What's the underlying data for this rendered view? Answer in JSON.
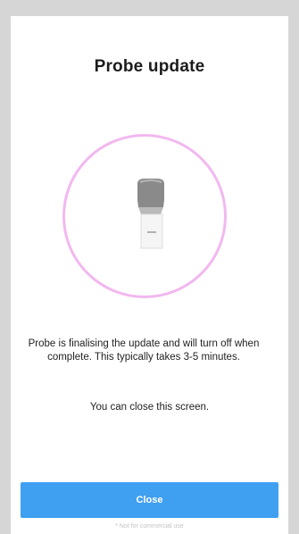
{
  "screen": {
    "title": "Probe update",
    "message": "Probe is finalising the update and will turn off when complete. This typically takes 3-5 minutes.",
    "close_note": "You can close this screen.",
    "close_button_label": "Close",
    "footnote": "* Not for commercial use",
    "ring_color": "#f2b8ef",
    "button_color": "#3f9ff0",
    "icon": "ultrasound-probe-icon"
  }
}
